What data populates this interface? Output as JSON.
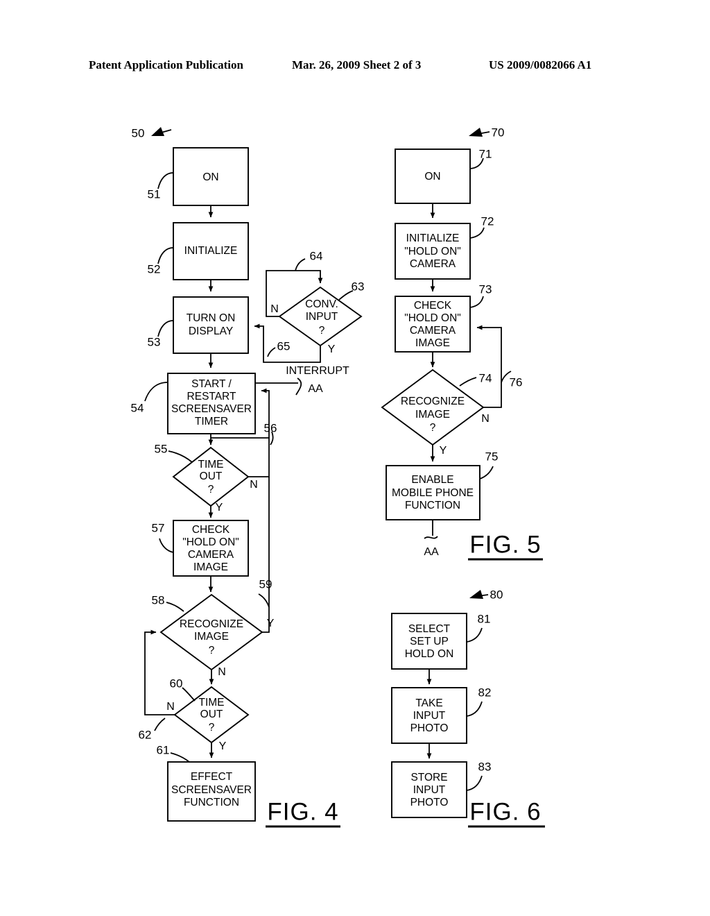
{
  "header": {
    "publication": "Patent Application Publication",
    "date_sheet": "Mar. 26, 2009  Sheet 2 of 3",
    "patent_number": "US 2009/0082066 A1"
  },
  "figures": [
    {
      "id": "fig4",
      "label": "FIG. 4",
      "flow_ref": "50",
      "nodes": [
        {
          "ref": "51",
          "type": "process",
          "text": [
            "ON"
          ]
        },
        {
          "ref": "52",
          "type": "process",
          "text": [
            "INITIALIZE"
          ]
        },
        {
          "ref": "53",
          "type": "process",
          "text": [
            "TURN ON",
            "DISPLAY"
          ]
        },
        {
          "ref": "54",
          "type": "process",
          "text": [
            "START /",
            "RESTART",
            "SCREENSAVER",
            "TIMER"
          ]
        },
        {
          "ref": "55",
          "type": "decision",
          "text": [
            "TIME",
            "OUT",
            "?"
          ]
        },
        {
          "ref": "57",
          "type": "process",
          "text": [
            "CHECK",
            "\"HOLD ON\"",
            "CAMERA",
            "IMAGE"
          ]
        },
        {
          "ref": "58",
          "type": "decision",
          "text": [
            "RECOGNIZE",
            "IMAGE",
            "?"
          ]
        },
        {
          "ref": "60",
          "type": "decision",
          "text": [
            "TIME",
            "OUT",
            "?"
          ]
        },
        {
          "ref": "61",
          "type": "process",
          "text": [
            "EFFECT",
            "SCREENSAVER",
            "FUNCTION"
          ]
        },
        {
          "ref": "63",
          "type": "decision",
          "text": [
            "CONV.",
            "INPUT",
            "?"
          ]
        }
      ],
      "connector_refs": [
        "56",
        "59",
        "62",
        "64",
        "65"
      ],
      "branch_labels": {
        "d55_no": "N",
        "d55_yes": "Y",
        "d58_yes": "Y",
        "d58_no": "N",
        "d60_no": "N",
        "d60_yes": "Y",
        "d63_no": "N",
        "d63_yes": "Y"
      },
      "annotations": {
        "interrupt": "INTERRUPT",
        "offpage": "AA"
      }
    },
    {
      "id": "fig5",
      "label": "FIG. 5",
      "flow_ref": "70",
      "nodes": [
        {
          "ref": "71",
          "type": "process",
          "text": [
            "ON"
          ]
        },
        {
          "ref": "72",
          "type": "process",
          "text": [
            "INITIALIZE",
            "\"HOLD ON\"",
            "CAMERA"
          ]
        },
        {
          "ref": "73",
          "type": "process",
          "text": [
            "CHECK",
            "\"HOLD ON\"",
            "CAMERA",
            "IMAGE"
          ]
        },
        {
          "ref": "74",
          "type": "decision",
          "text": [
            "RECOGNIZE",
            "IMAGE",
            "?"
          ]
        },
        {
          "ref": "75",
          "type": "process",
          "text": [
            "ENABLE",
            "MOBILE PHONE",
            "FUNCTION"
          ]
        }
      ],
      "connector_refs": [
        "76"
      ],
      "branch_labels": {
        "d74_no": "N",
        "d74_yes": "Y"
      },
      "annotations": {
        "offpage": "AA"
      }
    },
    {
      "id": "fig6",
      "label": "FIG. 6",
      "flow_ref": "80",
      "nodes": [
        {
          "ref": "81",
          "type": "process",
          "text": [
            "SELECT",
            "SET UP",
            "HOLD ON"
          ]
        },
        {
          "ref": "82",
          "type": "process",
          "text": [
            "TAKE",
            "INPUT",
            "PHOTO"
          ]
        },
        {
          "ref": "83",
          "type": "process",
          "text": [
            "STORE",
            "INPUT",
            "PHOTO"
          ]
        }
      ],
      "connector_refs": [],
      "branch_labels": {},
      "annotations": {}
    }
  ],
  "colors": {
    "ink": "#000000",
    "paper": "#ffffff"
  }
}
